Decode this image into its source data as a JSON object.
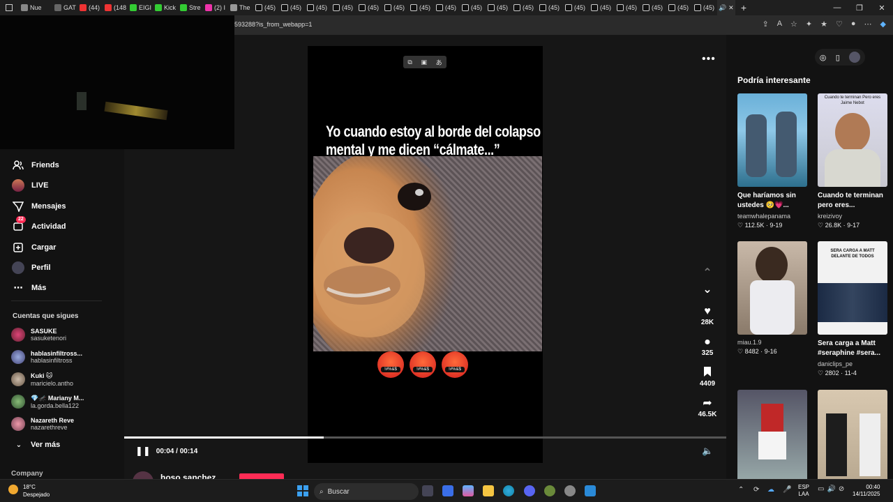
{
  "browser": {
    "tabs": [
      "Nue",
      "GAT",
      "(44)",
      "(148",
      "EIGI",
      "Kick",
      "Stre",
      "(2) I",
      "The",
      "(45)",
      "(45)",
      "(45)",
      "(45)",
      "(45)",
      "(45)",
      "(45)",
      "(45)",
      "(45)",
      "(45)",
      "(45)",
      "(45)",
      "(45)",
      "(45)",
      "(45)",
      "(45)",
      "(45)",
      "(45)"
    ],
    "url": "593288?is_from_webapp=1"
  },
  "nav": {
    "items": [
      {
        "label": "Friends",
        "icon": "friends-icon"
      },
      {
        "label": "LIVE",
        "icon": "live-icon"
      },
      {
        "label": "Mensajes",
        "icon": "messages-icon"
      },
      {
        "label": "Actividad",
        "icon": "activity-icon",
        "badge": "22"
      },
      {
        "label": "Cargar",
        "icon": "upload-icon"
      },
      {
        "label": "Perfil",
        "icon": "profile-icon"
      },
      {
        "label": "Más",
        "icon": "more-icon"
      }
    ],
    "following_title": "Cuentas que sigues",
    "following": [
      {
        "name": "SASUKE",
        "user": "sasuketenori"
      },
      {
        "name": "hablasinfiltross...",
        "user": "hablasinfiltross"
      },
      {
        "name": "Kuki 🐱",
        "user": "maricielo.antho"
      },
      {
        "name": "💎🦟 Mariany M...",
        "user": "la.gorda.bella122"
      },
      {
        "name": "Nazareth Reve",
        "user": "nazarethreve"
      }
    ],
    "see_more": "Ver más",
    "company": "Company"
  },
  "video": {
    "caption_line1": "Yo cuando estoy al borde del colapso",
    "caption_line2": "mental y me dicen “cálmate...”",
    "emoji_text": "!#%&$",
    "likes": "28K",
    "comments": "325",
    "saves": "4409",
    "shares": "46.5K",
    "time": "00:04 / 00:14",
    "progress": 0.3309,
    "author": "hoso sanchez"
  },
  "recommended": {
    "title": "Podría interesante",
    "cards": [
      {
        "title": "Que haríamos sin ustedes 🥺💗...",
        "user": "teamwhalepanama",
        "stats": "♡ 112.5K · 9-19",
        "thumb_text": ""
      },
      {
        "title": "Cuando te terminan pero eres...",
        "user": "kreizivoy",
        "stats": "♡ 26.8K · 9-17",
        "thumb_text": "Cuando te terminan Pero eres Jaime Nebot"
      },
      {
        "title": "",
        "user": "miau.1.9",
        "stats": "♡ 8482 · 9-16",
        "thumb_text": ""
      },
      {
        "title": "Sera carga a Matt #seraphine #sera...",
        "user": "daniclips_pe",
        "stats": "♡ 2802 · 11-4",
        "thumb_text": "SERA CARGA A MATT DELANTE DE TODOS"
      }
    ]
  },
  "taskbar": {
    "weather_temp": "18°C",
    "weather_desc": "Despejado",
    "search": "Buscar",
    "lang1": "ESP",
    "lang2": "LAA",
    "time": "00:40",
    "date": "14/11/2025"
  }
}
